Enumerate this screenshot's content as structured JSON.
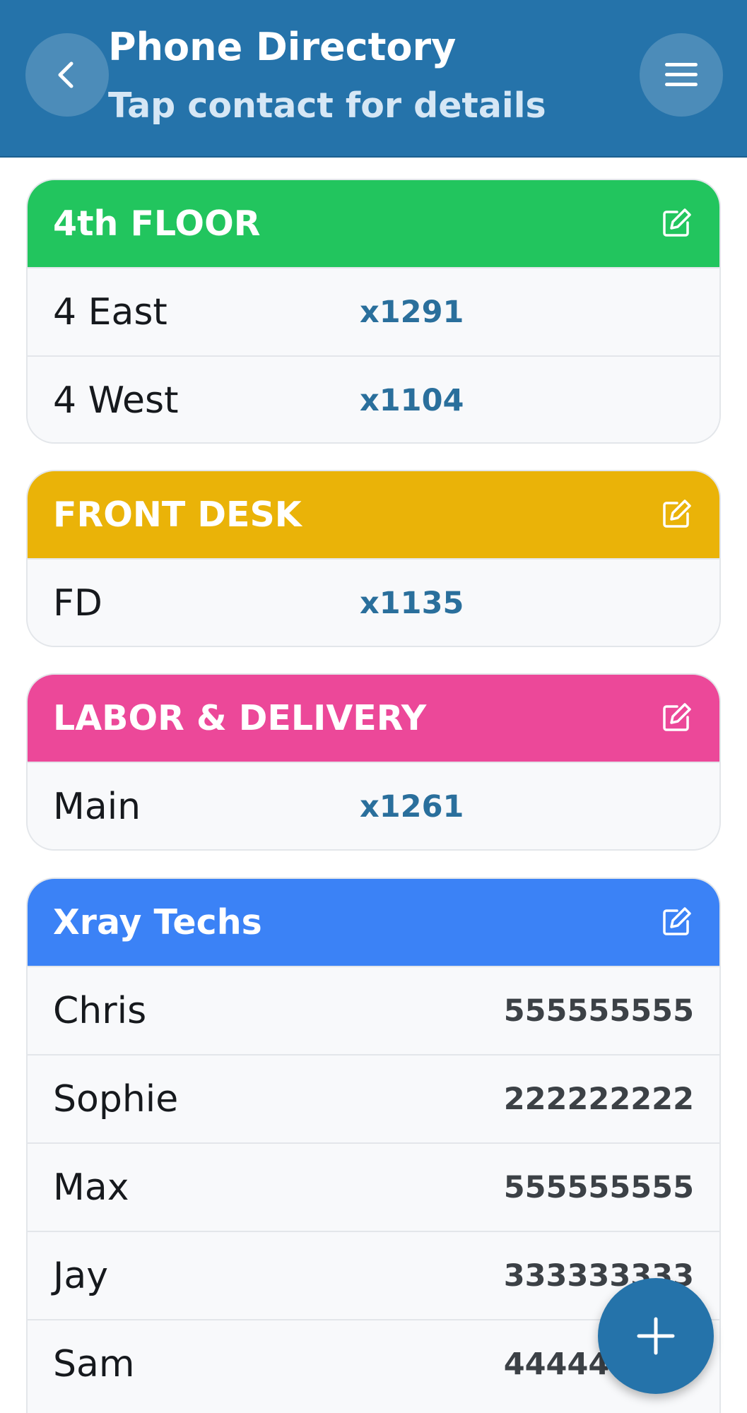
{
  "header": {
    "title": "Phone Directory",
    "subtitle": "Tap contact for details",
    "background_color": "#2573aa",
    "back_icon": "chevron-left-icon",
    "menu_icon": "hamburger-menu-icon"
  },
  "sections": [
    {
      "title": "4th FLOOR",
      "color": "#22c55e",
      "contacts": [
        {
          "name": "4 East",
          "number": "x1291"
        },
        {
          "name": "4 West",
          "number": "x1104"
        }
      ]
    },
    {
      "title": "FRONT DESK",
      "color": "#eab308",
      "contacts": [
        {
          "name": "FD",
          "number": "x1135"
        }
      ]
    },
    {
      "title": "LABOR & DELIVERY",
      "color": "#ec4899",
      "contacts": [
        {
          "name": "Main",
          "number": "x1261"
        }
      ]
    },
    {
      "title": "Xray Techs",
      "color": "#3b82f6",
      "contacts": [
        {
          "name": "Chris",
          "number": "555555555"
        },
        {
          "name": "Sophie",
          "number": "222222222"
        },
        {
          "name": "Max",
          "number": "555555555"
        },
        {
          "name": "Jay",
          "number": "333333333"
        },
        {
          "name": "Sam",
          "number": "444444444"
        }
      ]
    }
  ],
  "fab": {
    "icon": "plus-icon",
    "color": "#2573aa"
  }
}
